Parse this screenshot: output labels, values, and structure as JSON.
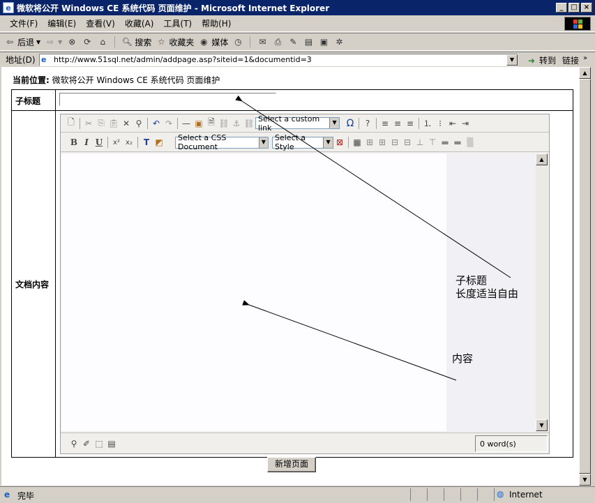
{
  "window": {
    "title": "微软将公开 Windows CE 系统代码 页面维护 - Microsoft Internet Explorer"
  },
  "menu": [
    "文件(F)",
    "编辑(E)",
    "查看(V)",
    "收藏(A)",
    "工具(T)",
    "帮助(H)"
  ],
  "toolbar": {
    "back": "后退",
    "search": "搜索",
    "favorites": "收藏夹",
    "media": "媒体"
  },
  "address": {
    "label": "地址(D)",
    "url": "http://www.51sql.net/admin/addpage.asp?siteid=1&documentid=3",
    "go": "转到",
    "links": "链接"
  },
  "page": {
    "location_label": "当前位置:",
    "location_text": "微软将公开 Windows CE 系统代码 页面维护",
    "subtitle_label": "子标题",
    "subtitle_value": "",
    "content_label": "文档内容",
    "submit": "新增页面"
  },
  "editor": {
    "custom_link": "Select a custom link",
    "css_doc": "Select a CSS Document",
    "style": "Select a Style",
    "word_count": "0 word(s)"
  },
  "annotations": {
    "subtitle_note_1": "子标题",
    "subtitle_note_2": "长度适当自由",
    "content_note": "内容"
  },
  "status": {
    "text": "完毕",
    "zone": "Internet"
  }
}
